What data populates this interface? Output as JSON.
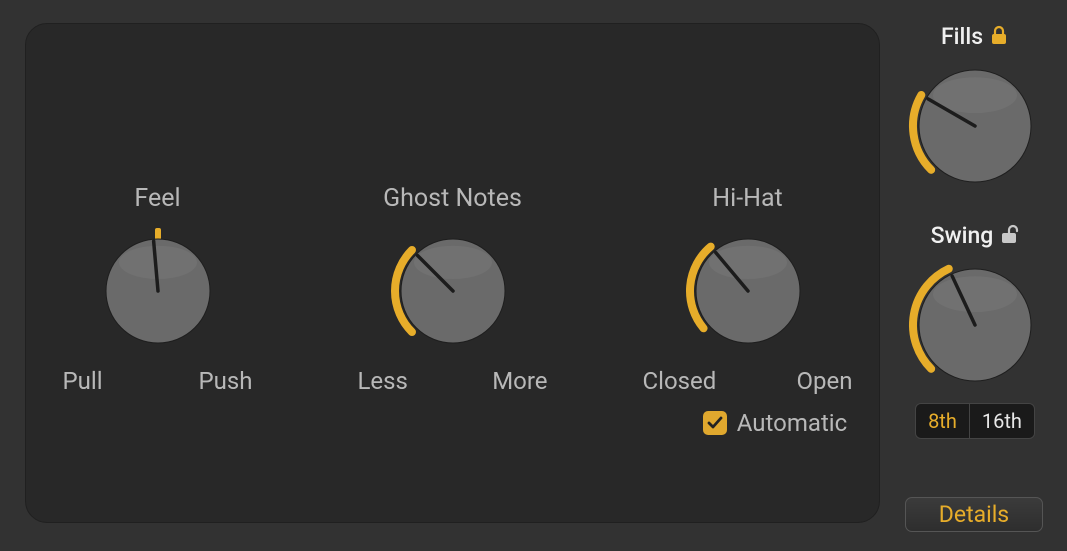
{
  "colors": {
    "accent": "#e7ad2a",
    "knobFace": "#6a6a6a",
    "tick": "#1c1c1c"
  },
  "main": {
    "feel": {
      "title": "Feel",
      "left": "Pull",
      "right": "Push",
      "radius": 52,
      "arcStart": 270,
      "arcEnd": 270,
      "pointerDeg": 265
    },
    "ghost": {
      "title": "Ghost Notes",
      "left": "Less",
      "right": "More",
      "radius": 52,
      "arcStart": 135,
      "arcEnd": 225,
      "pointerDeg": 225
    },
    "hihat": {
      "title": "Hi-Hat",
      "left": "Closed",
      "right": "Open",
      "radius": 52,
      "arcStart": 140,
      "arcEnd": 230,
      "pointerDeg": 230,
      "checkbox": {
        "checked": true,
        "label": "Automatic"
      }
    }
  },
  "side": {
    "fills": {
      "title": "Fills",
      "locked": true,
      "radius": 56,
      "arcStart": 135,
      "arcEnd": 210,
      "pointerDeg": 210
    },
    "swing": {
      "title": "Swing",
      "locked": false,
      "radius": 56,
      "arcStart": 135,
      "arcEnd": 245,
      "pointerDeg": 245,
      "segmented": {
        "options": [
          "8th",
          "16th"
        ],
        "active": "8th"
      }
    }
  },
  "details_label": "Details"
}
